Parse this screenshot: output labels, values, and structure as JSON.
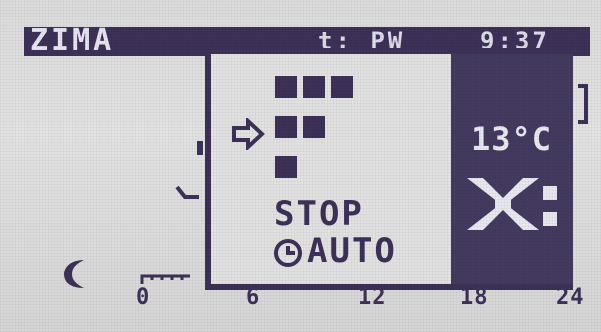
{
  "status_bar": {
    "mode": "ZIMA",
    "day_indicator": "t: PW",
    "time": "9:37"
  },
  "popup": {
    "state": "STOP",
    "mode": "AUTO",
    "temperature": "13°C",
    "fan_icon": "fan-off-icon",
    "arrow_icon": "arrow-right-icon",
    "clock_icon": "clock-icon"
  },
  "night_icon": "moon-icon",
  "timeline": {
    "labels": [
      "0",
      "6",
      "12",
      "18",
      "24"
    ]
  },
  "colors": {
    "lcd_background": "#dcdcdc",
    "pixel_dark": "#3d3158",
    "pixel_light": "#e6e6f0"
  }
}
